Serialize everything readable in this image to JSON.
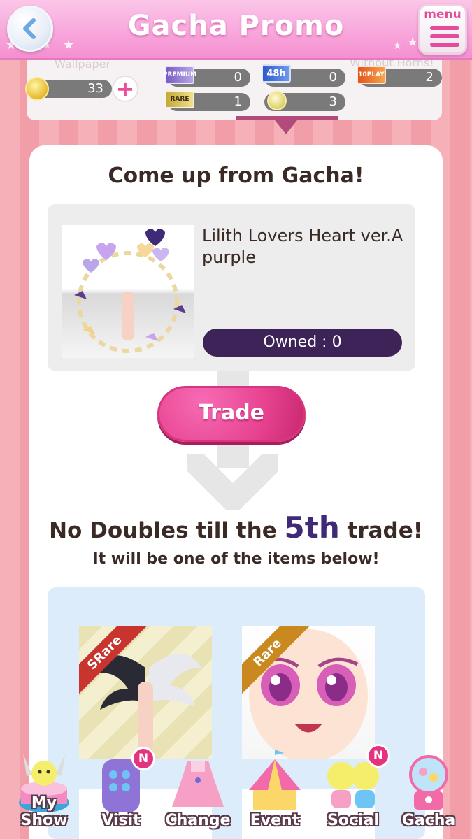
{
  "header": {
    "title": "Gacha Promo",
    "menu_label": "menu"
  },
  "strip": {
    "ghost_labels": [
      "Wallpaper",
      "Without Horns!"
    ],
    "coins": "33",
    "tickets": [
      {
        "name": "premium-ticket",
        "label": "PREMIUM",
        "count": "0"
      },
      {
        "name": "48h-ticket",
        "label": "48h",
        "count": "0"
      },
      {
        "name": "10play-ticket",
        "label": "10PLAY",
        "count": "2"
      },
      {
        "name": "rare-ticket",
        "label": "RARE",
        "count": "1"
      },
      {
        "name": "gem-ticket",
        "label": "",
        "count": "3"
      }
    ]
  },
  "main": {
    "title": "Come up from Gacha!",
    "item_name": "Lilith Lovers Heart ver.A purple",
    "owned": "Owned : 0",
    "trade_label": "Trade",
    "no_doubles_prefix": "No Doubles till the",
    "no_doubles_num": "5th",
    "no_doubles_suffix": "trade!",
    "subtext": "It will be one of the items below!",
    "prizes": [
      {
        "rarity": "SRare",
        "color": "#c8342e"
      },
      {
        "rarity": "Rare",
        "color": "#c9891f"
      }
    ]
  },
  "nav": [
    {
      "label": "My Show"
    },
    {
      "label": "Visit",
      "badge": "N"
    },
    {
      "label": "Change"
    },
    {
      "label": "Event"
    },
    {
      "label": "Social",
      "badge": "N"
    },
    {
      "label": "Gacha"
    }
  ],
  "colors": {
    "header_pink": "#f58fd1",
    "accent_pink": "#e6418f",
    "dark_purple": "#3e2358"
  }
}
